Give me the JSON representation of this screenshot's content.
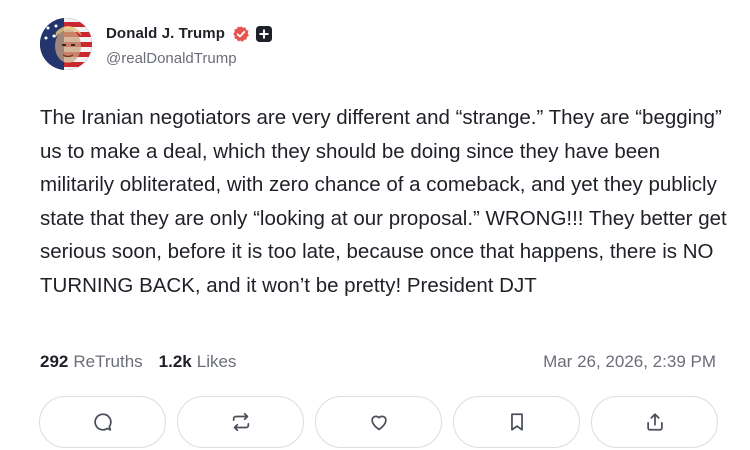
{
  "author": {
    "display_name": "Donald J. Trump",
    "handle": "@realDonaldTrump",
    "avatar_icon": "flag-portrait-avatar",
    "verified_icon": "verified-badge-icon",
    "verified_color": "#e8524f",
    "plus_icon": "plus-badge-icon"
  },
  "post": {
    "text": "The Iranian negotiators are very different and “strange.” They are “begging” us to make a deal, which they should be doing since they have been militarily obliterated, with zero chance of a comeback, and yet they publicly state that they are only “looking at our proposal.” WRONG!!! They better get serious soon, before it is too late, because once that happens, there is NO TURNING BACK, and it won’t be pretty! President DJT"
  },
  "stats": {
    "retruths_count": "292",
    "retruths_label": "ReTruths",
    "likes_count": "1.2k",
    "likes_label": "Likes",
    "timestamp": "Mar 26, 2026, 2:39 PM"
  },
  "actions": [
    {
      "icon": "reply-icon"
    },
    {
      "icon": "retruth-icon"
    },
    {
      "icon": "like-heart-icon"
    },
    {
      "icon": "bookmark-icon"
    },
    {
      "icon": "share-icon"
    }
  ],
  "colors": {
    "text": "#1f2128",
    "muted": "#6b6e78",
    "border": "#dcdde3"
  }
}
